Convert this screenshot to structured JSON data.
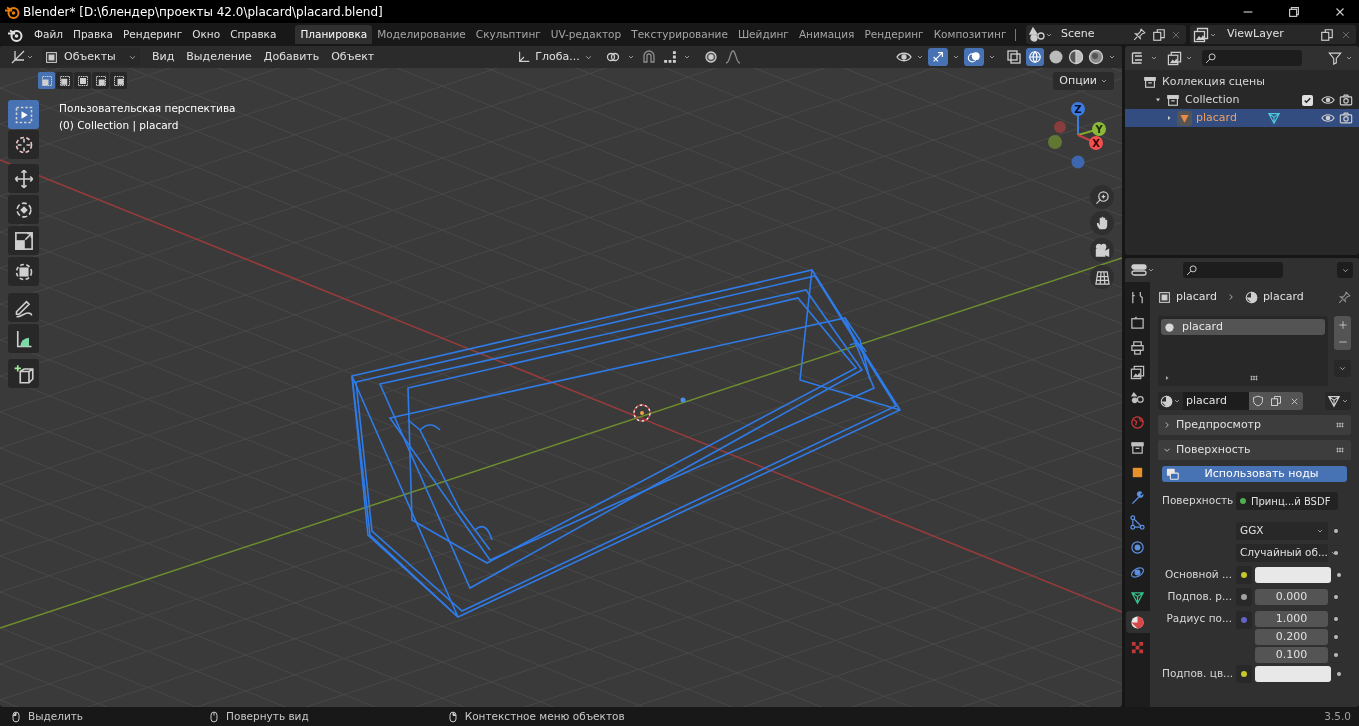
{
  "title_bar": {
    "title": "Blender* [D:\\блендер\\проекты 42.0\\placard\\placard.blend]"
  },
  "menu_bar": {
    "menus": [
      "Файл",
      "Правка",
      "Рендеринг",
      "Окно",
      "Справка"
    ],
    "workspaces": [
      {
        "label": "Планировка",
        "selected": true
      },
      {
        "label": "Моделирование",
        "selected": false
      },
      {
        "label": "Скульптинг",
        "selected": false
      },
      {
        "label": "UV-редактор",
        "selected": false
      },
      {
        "label": "Текстурирование",
        "selected": false
      },
      {
        "label": "Шейдинг",
        "selected": false
      },
      {
        "label": "Анимация",
        "selected": false
      },
      {
        "label": "Рендеринг",
        "selected": false
      },
      {
        "label": "Композитинг",
        "selected": false
      }
    ],
    "scene": "Scene",
    "view_layer": "ViewLayer"
  },
  "viewport": {
    "mode": "Объекты",
    "menus": [
      "Вид",
      "Выделение",
      "Добавить",
      "Объект"
    ],
    "orientation": "Глоба...",
    "select_modes": [
      {
        "selected": true
      },
      {
        "selected": false
      },
      {
        "selected": false
      },
      {
        "selected": false
      },
      {
        "selected": false
      }
    ],
    "options": "Опции",
    "view_name": "Пользовательская перспектива",
    "context": "(0) Collection | placard",
    "tools": [
      {
        "selected": true
      },
      {
        "selected": false
      },
      {
        "selected": false
      },
      {
        "selected": false
      },
      {
        "selected": false
      },
      {
        "selected": false
      },
      {
        "selected": false
      },
      {
        "selected": false
      },
      {
        "selected": false
      }
    ],
    "gizmo_axes": [
      "X",
      "Y",
      "Z"
    ]
  },
  "outliner": {
    "items": [
      {
        "label": "Коллекция сцены",
        "selected": false,
        "children": [
          {
            "label": "Collection",
            "selected": false,
            "checked": true,
            "children": [
              {
                "label": "placard",
                "selected": true
              }
            ]
          }
        ]
      }
    ]
  },
  "properties": {
    "tabs": [
      {
        "selected": false
      },
      {
        "selected": false
      },
      {
        "selected": false
      },
      {
        "selected": false
      },
      {
        "selected": false
      },
      {
        "selected": false
      },
      {
        "selected": false
      },
      {
        "selected": false
      },
      {
        "selected": false
      },
      {
        "selected": false
      },
      {
        "selected": false
      },
      {
        "selected": false
      },
      {
        "selected": false
      },
      {
        "selected": true
      },
      {
        "selected": false
      }
    ],
    "breadcrumb": [
      "placard",
      "placard"
    ],
    "material_slots": [
      {
        "label": "placard",
        "selected": true
      }
    ],
    "material": "placard",
    "panels": [
      {
        "label": "Предпросмотр",
        "expanded": false
      },
      {
        "label": "Поверхность",
        "expanded": true,
        "use_nodes": "Использовать ноды",
        "rows": [
          {
            "kind": "socket",
            "label": "Поверхность",
            "value": "Принц...й BSDF",
            "color": "#4fae4f"
          },
          {
            "kind": "dropdown",
            "value": "GGX"
          },
          {
            "kind": "dropdown",
            "value": "Случайный об..."
          },
          {
            "kind": "color",
            "label": "Основной ...",
            "color": "#c7c729"
          },
          {
            "kind": "number",
            "label": "Подпов. р...",
            "value": "0.000",
            "color": "#a1a1a1"
          },
          {
            "kind": "vector",
            "label": "Радиус по...",
            "values": [
              "1.000",
              "0.200",
              "0.100"
            ],
            "color": "#6363c7"
          },
          {
            "kind": "color",
            "label": "Подпов. цв...",
            "color": "#c7c729"
          }
        ]
      }
    ]
  },
  "status_bar": {
    "hints": [
      "Выделить",
      "Повернуть вид",
      "Контекстное меню объектов"
    ],
    "version": "3.5.0"
  }
}
